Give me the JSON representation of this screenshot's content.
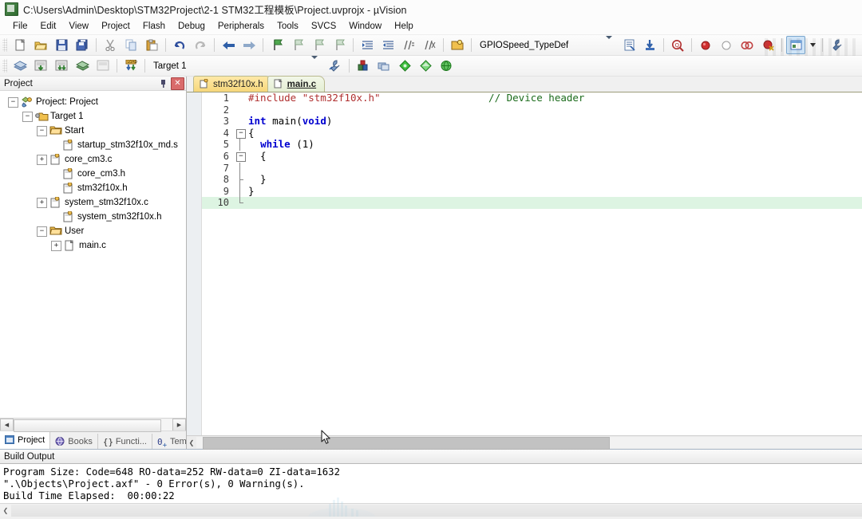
{
  "window": {
    "title": "C:\\Users\\Admin\\Desktop\\STM32Project\\2-1 STM32工程模板\\Project.uvprojx - µVision",
    "app_icon": "uvision-icon"
  },
  "menu": {
    "items": [
      {
        "label": "File"
      },
      {
        "label": "Edit"
      },
      {
        "label": "View"
      },
      {
        "label": "Project"
      },
      {
        "label": "Flash"
      },
      {
        "label": "Debug"
      },
      {
        "label": "Peripherals"
      },
      {
        "label": "Tools"
      },
      {
        "label": "SVCS"
      },
      {
        "label": "Window"
      },
      {
        "label": "Help"
      }
    ]
  },
  "toolbar_main": {
    "buttons": [
      {
        "name": "new-file-icon",
        "tip": "New"
      },
      {
        "name": "open-file-icon",
        "tip": "Open"
      },
      {
        "name": "save-icon",
        "tip": "Save"
      },
      {
        "name": "save-all-icon",
        "tip": "Save All"
      },
      {
        "name": "cut-icon",
        "tip": "Cut"
      },
      {
        "name": "copy-icon",
        "tip": "Copy"
      },
      {
        "name": "paste-icon",
        "tip": "Paste"
      },
      {
        "name": "undo-icon",
        "tip": "Undo"
      },
      {
        "name": "redo-icon",
        "tip": "Redo"
      },
      {
        "name": "navigate-back-icon",
        "tip": "Back"
      },
      {
        "name": "navigate-forward-icon",
        "tip": "Forward"
      },
      {
        "name": "bookmark-toggle-icon",
        "tip": "Insert/Remove Bookmark"
      },
      {
        "name": "bookmark-prev-icon",
        "tip": "Previous Bookmark"
      },
      {
        "name": "bookmark-next-icon",
        "tip": "Next Bookmark"
      },
      {
        "name": "bookmark-clear-icon",
        "tip": "Clear All Bookmarks"
      },
      {
        "name": "indent-right-icon",
        "tip": "Indent"
      },
      {
        "name": "indent-left-icon",
        "tip": "Outdent"
      },
      {
        "name": "comment-icon",
        "tip": "Comment"
      },
      {
        "name": "uncomment-icon",
        "tip": "Uncomment"
      },
      {
        "name": "open-project-icon",
        "tip": "Open Project"
      }
    ]
  },
  "symbol_combo": {
    "value": "GPIOSpeed_TypeDef",
    "arrow": "chevron-down-icon"
  },
  "toolbar_right": {
    "buttons": [
      {
        "name": "browse-symbols-icon",
        "tip": "Browse Symbols"
      },
      {
        "name": "goto-definition-icon",
        "tip": "Go To Definition"
      },
      {
        "name": "find-in-files-icon",
        "tip": "Find in Files"
      },
      {
        "name": "breakpoint-insert-icon",
        "tip": "Insert/Remove Breakpoint"
      },
      {
        "name": "breakpoint-enable-icon",
        "tip": "Enable/Disable Breakpoint"
      },
      {
        "name": "breakpoint-disable-all-icon",
        "tip": "Disable All Breakpoints"
      },
      {
        "name": "breakpoint-kill-all-icon",
        "tip": "Kill All Breakpoints"
      },
      {
        "name": "manage-windows-icon",
        "tip": "Manage Windows"
      },
      {
        "name": "configure-icon",
        "tip": "Configuration Wizard"
      }
    ]
  },
  "toolbar_build": {
    "buttons": [
      {
        "name": "translate-icon",
        "tip": "Translate"
      },
      {
        "name": "build-icon",
        "tip": "Build"
      },
      {
        "name": "rebuild-icon",
        "tip": "Rebuild"
      },
      {
        "name": "batch-build-icon",
        "tip": "Batch Build"
      },
      {
        "name": "stop-build-icon",
        "tip": "Stop Build"
      },
      {
        "name": "download-icon",
        "tip": "Download"
      }
    ],
    "target": {
      "value": "Target 1",
      "arrow": "chevron-down-icon"
    },
    "right_buttons": [
      {
        "name": "target-options-icon",
        "tip": "Options for Target"
      },
      {
        "name": "manage-project-items-icon",
        "tip": "Manage Project Items"
      },
      {
        "name": "multi-project-icon",
        "tip": "Manage Multi-Project"
      },
      {
        "name": "pack-installer-icon",
        "tip": "Pack Installer"
      },
      {
        "name": "run-manage-icon",
        "tip": "Manage Run-Time Environment"
      }
    ]
  },
  "project_panel": {
    "title": "Project",
    "pin_icon": "pin-icon",
    "close_icon": "close-icon",
    "tree": [
      {
        "depth": 0,
        "label": "Project: Project",
        "icon": "project-icon",
        "expander": "-"
      },
      {
        "depth": 1,
        "label": "Target 1",
        "icon": "target-folder-icon",
        "expander": "-"
      },
      {
        "depth": 2,
        "label": "Start",
        "icon": "folder-icon",
        "expander": "-"
      },
      {
        "depth": 3,
        "label": "startup_stm32f10x_md.s",
        "icon": "asm-file-icon",
        "expander": ""
      },
      {
        "depth": 3,
        "label": "core_cm3.c",
        "icon": "c-file-icon",
        "expander": "+"
      },
      {
        "depth": 3,
        "label": "core_cm3.h",
        "icon": "h-file-icon",
        "expander": ""
      },
      {
        "depth": 3,
        "label": "stm32f10x.h",
        "icon": "h-file-icon",
        "expander": ""
      },
      {
        "depth": 3,
        "label": "system_stm32f10x.c",
        "icon": "c-file-icon",
        "expander": "+"
      },
      {
        "depth": 3,
        "label": "system_stm32f10x.h",
        "icon": "h-file-icon",
        "expander": ""
      },
      {
        "depth": 2,
        "label": "User",
        "icon": "folder-icon",
        "expander": "-"
      },
      {
        "depth": 3,
        "label": "main.c",
        "icon": "plain-file-icon",
        "expander": "+"
      }
    ],
    "tabs": [
      {
        "label": "Project",
        "icon": "project-tab-icon",
        "selected": true
      },
      {
        "label": "Books",
        "icon": "books-tab-icon",
        "selected": false
      },
      {
        "label": "Functi...",
        "icon": "functions-tab-icon",
        "selected": false
      },
      {
        "label": "Templ...",
        "icon": "templates-tab-icon",
        "selected": false
      }
    ]
  },
  "editor": {
    "tabs": [
      {
        "label": "stm32f10x.h",
        "icon": "h-file-icon",
        "active": false
      },
      {
        "label": "main.c",
        "icon": "c-file-icon",
        "active": true
      }
    ],
    "lines": [
      {
        "num": "1",
        "fold": "none",
        "tokens": [
          {
            "t": "#include ",
            "c": "pp"
          },
          {
            "t": "\"stm32f10x.h\"",
            "c": "str"
          },
          {
            "t": "                  ",
            "c": "pl"
          },
          {
            "t": "// Device header",
            "c": "cmt"
          }
        ]
      },
      {
        "num": "2",
        "fold": "none",
        "tokens": []
      },
      {
        "num": "3",
        "fold": "none",
        "tokens": [
          {
            "t": "int ",
            "c": "kw"
          },
          {
            "t": "main(",
            "c": "pl"
          },
          {
            "t": "void",
            "c": "kw"
          },
          {
            "t": ")",
            "c": "pl"
          }
        ]
      },
      {
        "num": "4",
        "fold": "minus",
        "tokens": [
          {
            "t": "{",
            "c": "pl"
          }
        ]
      },
      {
        "num": "5",
        "fold": "line",
        "tokens": [
          {
            "t": "  ",
            "c": "pl"
          },
          {
            "t": "while",
            "c": "kw"
          },
          {
            "t": " (1)",
            "c": "pl"
          }
        ]
      },
      {
        "num": "6",
        "fold": "minus",
        "tokens": [
          {
            "t": "  {",
            "c": "pl"
          }
        ]
      },
      {
        "num": "7",
        "fold": "line",
        "tokens": []
      },
      {
        "num": "8",
        "fold": "tick",
        "tokens": [
          {
            "t": "  }",
            "c": "pl"
          }
        ]
      },
      {
        "num": "9",
        "fold": "line",
        "tokens": [
          {
            "t": "}",
            "c": "pl"
          }
        ]
      },
      {
        "num": "10",
        "fold": "end",
        "tokens": [],
        "highlight": true
      }
    ]
  },
  "build_output": {
    "title": "Build Output",
    "lines": [
      "Program Size: Code=648 RO-data=252 RW-data=0 ZI-data=1632",
      "\".\\Objects\\Project.axf\" - 0 Error(s), 0 Warning(s).",
      "Build Time Elapsed:  00:00:22"
    ],
    "scroll_left_icon": "chevron-left-icon"
  },
  "colors": {
    "tab_active": "#e4eed3",
    "tab_inactive": "#f6d77a",
    "current_line": "#ddf4e2",
    "keyword": "#0000d0",
    "string": "#b03030",
    "comment": "#1b6b1b",
    "close_button": "#d96b6b"
  }
}
